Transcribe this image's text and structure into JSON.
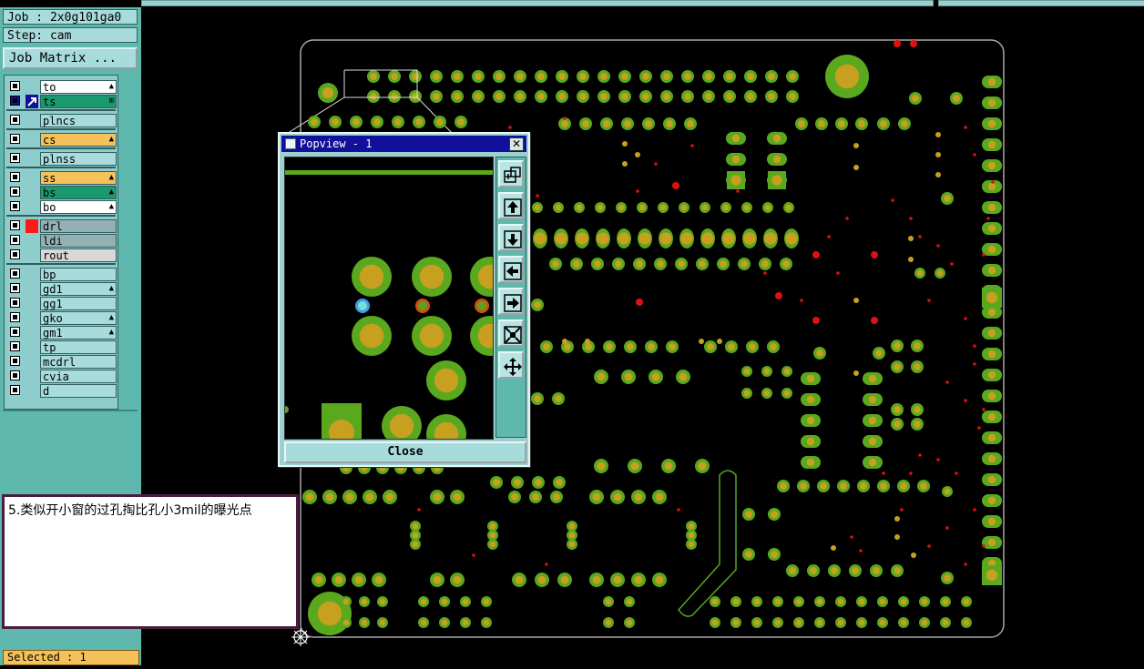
{
  "job": {
    "label": "Job : 2x0g101ga0",
    "step": "Step: cam",
    "matrix_button": "Job Matrix ..."
  },
  "layers": [
    {
      "name": "to",
      "color": "#ffffff",
      "marker": "▲"
    },
    {
      "name": "ts",
      "color": "#1a9a6c",
      "marker": "⊞"
    },
    {
      "name": "plncs",
      "color": "#a8dcdc",
      "marker": ""
    },
    {
      "name": "cs",
      "color": "#f5c15a",
      "marker": "▲"
    },
    {
      "name": "plnss",
      "color": "#a8dcdc",
      "marker": ""
    },
    {
      "name": "ss",
      "color": "#f5c15a",
      "marker": "▲"
    },
    {
      "name": "bs",
      "color": "#1a9a6c",
      "marker": "▲"
    },
    {
      "name": "bo",
      "color": "#ffffff",
      "marker": "▲"
    },
    {
      "name": "drl",
      "color": "#94b0b4",
      "marker": ""
    },
    {
      "name": "ldi",
      "color": "#94b0b4",
      "marker": ""
    },
    {
      "name": "rout",
      "color": "#d8d8d8",
      "marker": ""
    },
    {
      "name": "bp",
      "color": "#a8dcdc",
      "marker": ""
    },
    {
      "name": "gd1",
      "color": "#a8dcdc",
      "marker": "▲"
    },
    {
      "name": "gg1",
      "color": "#a8dcdc",
      "marker": ""
    },
    {
      "name": "gko",
      "color": "#a8dcdc",
      "marker": "▲"
    },
    {
      "name": "gm1",
      "color": "#a8dcdc",
      "marker": "▲"
    },
    {
      "name": "tp",
      "color": "#a8dcdc",
      "marker": ""
    },
    {
      "name": "mcdrl",
      "color": "#a8dcdc",
      "marker": ""
    },
    {
      "name": "cvia",
      "color": "#a8dcdc",
      "marker": ""
    },
    {
      "name": "d",
      "color": "#a8dcdc",
      "marker": ""
    }
  ],
  "status": {
    "selected": "Selected : 1"
  },
  "popview": {
    "title": "Popview - 1",
    "close_x": "✕",
    "close_label": "Close"
  },
  "note": {
    "text": "5.类似开小窗的过孔掏比孔小3mil的曝光点"
  },
  "colors": {
    "pad_ring": "#5aa81e",
    "pad_core": "#c8a020",
    "board_outline": "#a7a7a7",
    "drill": "#e01010",
    "panel": "#5fb8ad",
    "title_bar": "#10109a"
  },
  "tool_icons": [
    "zoom-area-icon",
    "pan-up-icon",
    "pan-down-icon",
    "pan-left-icon",
    "pan-right-icon",
    "zoom-fit-icon",
    "zoom-expand-icon"
  ]
}
